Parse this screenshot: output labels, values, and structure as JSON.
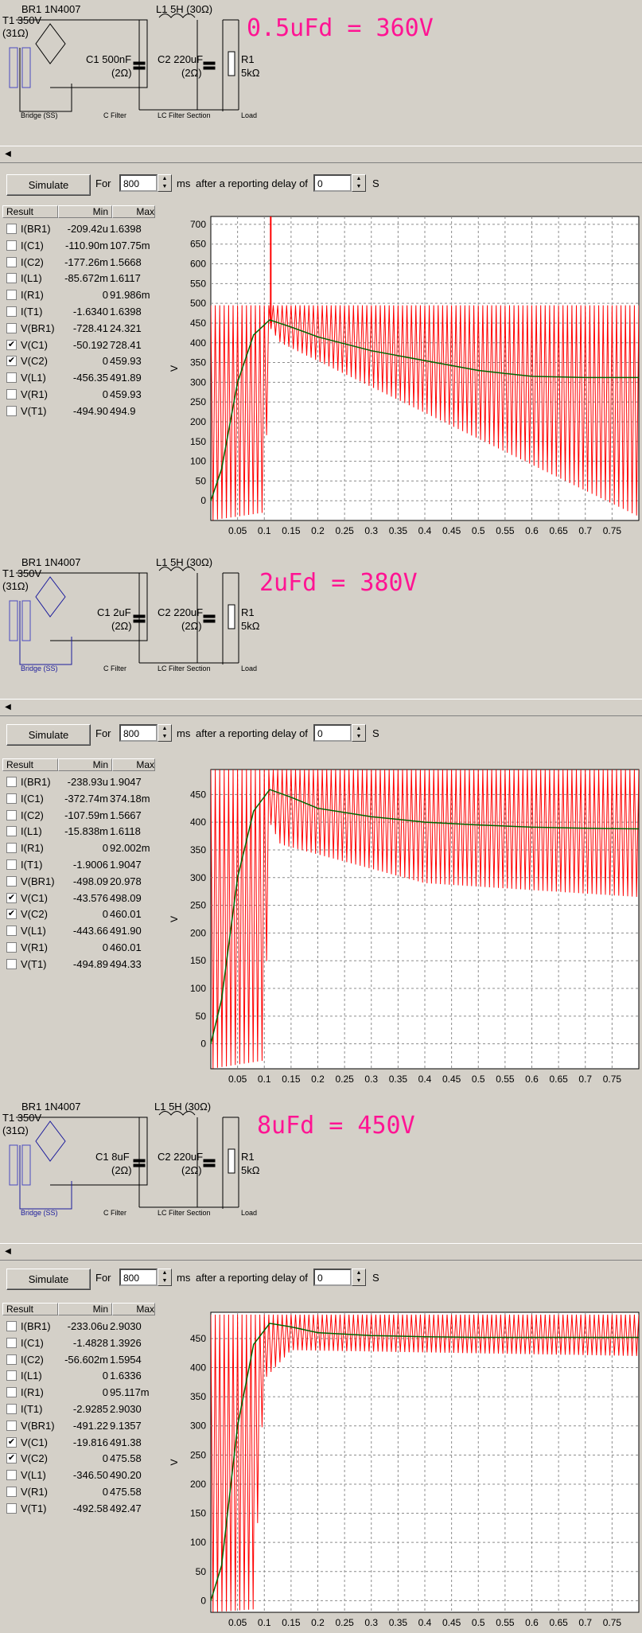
{
  "panels": [
    {
      "headline": "0.5uFd = 360V",
      "schematic": {
        "br1": "BR1 1N4007",
        "t1": "T1 350V",
        "t1_r": "(31Ω)",
        "l1": "L1 5H (30Ω)",
        "c1": "C1 500nF",
        "c1_r": "(2Ω)",
        "c2": "C2 220uF",
        "c2_r": "(2Ω)",
        "r1": "R1",
        "r1_v": "5kΩ",
        "sec_bridge": "Bridge (SS)",
        "sec_cfilter": "C Filter",
        "sec_lc": "LC Filter Section",
        "sec_load": "Load"
      },
      "toolbar": {
        "simulate": "Simulate",
        "for": "For",
        "ms": "800",
        "unit": "ms",
        "delay_text": "after a reporting delay of",
        "delay": "0",
        "s": "S"
      },
      "results": {
        "headers": [
          "Result",
          "Min",
          "Max"
        ],
        "rows": [
          {
            "name": "I(BR1)",
            "min": "-209.42u",
            "max": "1.6398",
            "checked": false
          },
          {
            "name": "I(C1)",
            "min": "-110.90m",
            "max": "107.75m",
            "checked": false
          },
          {
            "name": "I(C2)",
            "min": "-177.26m",
            "max": "1.5668",
            "checked": false
          },
          {
            "name": "I(L1)",
            "min": "-85.672m",
            "max": "1.6117",
            "checked": false
          },
          {
            "name": "I(R1)",
            "min": "0",
            "max": "91.986m",
            "checked": false
          },
          {
            "name": "I(T1)",
            "min": "-1.6340",
            "max": "1.6398",
            "checked": false
          },
          {
            "name": "V(BR1)",
            "min": "-728.41",
            "max": "24.321",
            "checked": false
          },
          {
            "name": "V(C1)",
            "min": "-50.192",
            "max": "728.41",
            "checked": true
          },
          {
            "name": "V(C2)",
            "min": "0",
            "max": "459.93",
            "checked": true
          },
          {
            "name": "V(L1)",
            "min": "-456.35",
            "max": "491.89",
            "checked": false
          },
          {
            "name": "V(R1)",
            "min": "0",
            "max": "459.93",
            "checked": false
          },
          {
            "name": "V(T1)",
            "min": "-494.90",
            "max": "494.9",
            "checked": false
          }
        ]
      },
      "chart_data": {
        "type": "line",
        "ylabel": "V",
        "xlim": [
          0,
          0.8
        ],
        "ylim": [
          -50,
          720
        ],
        "yticks": [
          0,
          50,
          100,
          150,
          200,
          250,
          300,
          350,
          400,
          450,
          500,
          550,
          600,
          650,
          700
        ],
        "xticks": [
          "0.05",
          "0.1",
          "0.15",
          "0.2",
          "0.25",
          "0.3",
          "0.35",
          "0.4",
          "0.45",
          "0.5",
          "0.55",
          "0.6",
          "0.65",
          "0.7",
          "0.75"
        ],
        "series": [
          {
            "name": "V(C1)",
            "color": "#ff0000",
            "peak": 495,
            "spike": 728,
            "envelope_low": [
              [
                0,
                -50
              ],
              [
                0.1,
                -30
              ],
              [
                0.11,
                440
              ],
              [
                0.13,
                400
              ],
              [
                0.8,
                -40
              ]
            ]
          },
          {
            "name": "V(C2)",
            "color": "#006400",
            "points": [
              [
                0,
                0
              ],
              [
                0.02,
                80
              ],
              [
                0.05,
                300
              ],
              [
                0.08,
                420
              ],
              [
                0.11,
                458
              ],
              [
                0.15,
                440
              ],
              [
                0.2,
                415
              ],
              [
                0.3,
                380
              ],
              [
                0.4,
                355
              ],
              [
                0.5,
                330
              ],
              [
                0.6,
                315
              ],
              [
                0.7,
                312
              ],
              [
                0.8,
                312
              ]
            ]
          }
        ]
      }
    },
    {
      "headline": "2uFd = 380V",
      "schematic": {
        "br1": "BR1 1N4007",
        "t1": "T1 350V",
        "t1_r": "(31Ω)",
        "l1": "L1 5H (30Ω)",
        "c1": "C1 2uF",
        "c1_r": "(2Ω)",
        "c2": "C2 220uF",
        "c2_r": "(2Ω)",
        "r1": "R1",
        "r1_v": "5kΩ",
        "sec_bridge": "Bridge (SS)",
        "sec_cfilter": "C Filter",
        "sec_lc": "LC Filter Section",
        "sec_load": "Load"
      },
      "toolbar": {
        "simulate": "Simulate",
        "for": "For",
        "ms": "800",
        "unit": "ms",
        "delay_text": "after a reporting delay of",
        "delay": "0",
        "s": "S"
      },
      "results": {
        "headers": [
          "Result",
          "Min",
          "Max"
        ],
        "rows": [
          {
            "name": "I(BR1)",
            "min": "-238.93u",
            "max": "1.9047",
            "checked": false
          },
          {
            "name": "I(C1)",
            "min": "-372.74m",
            "max": "374.18m",
            "checked": false
          },
          {
            "name": "I(C2)",
            "min": "-107.59m",
            "max": "1.5667",
            "checked": false
          },
          {
            "name": "I(L1)",
            "min": "-15.838m",
            "max": "1.6118",
            "checked": false
          },
          {
            "name": "I(R1)",
            "min": "0",
            "max": "92.002m",
            "checked": false
          },
          {
            "name": "I(T1)",
            "min": "-1.9006",
            "max": "1.9047",
            "checked": false
          },
          {
            "name": "V(BR1)",
            "min": "-498.09",
            "max": "20.978",
            "checked": false
          },
          {
            "name": "V(C1)",
            "min": "-43.576",
            "max": "498.09",
            "checked": true
          },
          {
            "name": "V(C2)",
            "min": "0",
            "max": "460.01",
            "checked": true
          },
          {
            "name": "V(L1)",
            "min": "-443.66",
            "max": "491.90",
            "checked": false
          },
          {
            "name": "V(R1)",
            "min": "0",
            "max": "460.01",
            "checked": false
          },
          {
            "name": "V(T1)",
            "min": "-494.89",
            "max": "494.33",
            "checked": false
          }
        ]
      },
      "chart_data": {
        "type": "line",
        "ylabel": "V",
        "xlim": [
          0,
          0.8
        ],
        "ylim": [
          -45,
          495
        ],
        "yticks": [
          0,
          50,
          100,
          150,
          200,
          250,
          300,
          350,
          400,
          450
        ],
        "xticks": [
          "0.05",
          "0.1",
          "0.15",
          "0.2",
          "0.25",
          "0.3",
          "0.35",
          "0.4",
          "0.45",
          "0.5",
          "0.55",
          "0.6",
          "0.65",
          "0.7",
          "0.75"
        ],
        "series": [
          {
            "name": "V(C1)",
            "color": "#ff0000",
            "peak": 495,
            "envelope_low": [
              [
                0,
                -45
              ],
              [
                0.1,
                -30
              ],
              [
                0.11,
                400
              ],
              [
                0.13,
                360
              ],
              [
                0.4,
                290
              ],
              [
                0.8,
                265
              ]
            ]
          },
          {
            "name": "V(C2)",
            "color": "#006400",
            "points": [
              [
                0,
                0
              ],
              [
                0.02,
                80
              ],
              [
                0.05,
                300
              ],
              [
                0.08,
                420
              ],
              [
                0.11,
                459
              ],
              [
                0.15,
                445
              ],
              [
                0.2,
                425
              ],
              [
                0.3,
                410
              ],
              [
                0.4,
                400
              ],
              [
                0.5,
                395
              ],
              [
                0.6,
                391
              ],
              [
                0.7,
                389
              ],
              [
                0.8,
                388
              ]
            ]
          }
        ]
      }
    },
    {
      "headline": "8uFd = 450V",
      "schematic": {
        "br1": "BR1 1N4007",
        "t1": "T1 350V",
        "t1_r": "(31Ω)",
        "l1": "L1 5H (30Ω)",
        "c1": "C1 8uF",
        "c1_r": "(2Ω)",
        "c2": "C2 220uF",
        "c2_r": "(2Ω)",
        "r1": "R1",
        "r1_v": "5kΩ",
        "sec_bridge": "Bridge (SS)",
        "sec_cfilter": "C Filter",
        "sec_lc": "LC Filter Section",
        "sec_load": "Load"
      },
      "toolbar": {
        "simulate": "Simulate",
        "for": "For",
        "ms": "800",
        "unit": "ms",
        "delay_text": "after a reporting delay of",
        "delay": "0",
        "s": "S"
      },
      "results": {
        "headers": [
          "Result",
          "Min",
          "Max"
        ],
        "rows": [
          {
            "name": "I(BR1)",
            "min": "-233.06u",
            "max": "2.9030",
            "checked": false
          },
          {
            "name": "I(C1)",
            "min": "-1.4828",
            "max": "1.3926",
            "checked": false
          },
          {
            "name": "I(C2)",
            "min": "-56.602m",
            "max": "1.5954",
            "checked": false
          },
          {
            "name": "I(L1)",
            "min": "0",
            "max": "1.6336",
            "checked": false
          },
          {
            "name": "I(R1)",
            "min": "0",
            "max": "95.117m",
            "checked": false
          },
          {
            "name": "I(T1)",
            "min": "-2.9285",
            "max": "2.9030",
            "checked": false
          },
          {
            "name": "V(BR1)",
            "min": "-491.22",
            "max": "9.1357",
            "checked": false
          },
          {
            "name": "V(C1)",
            "min": "-19.816",
            "max": "491.38",
            "checked": true
          },
          {
            "name": "V(C2)",
            "min": "0",
            "max": "475.58",
            "checked": true
          },
          {
            "name": "V(L1)",
            "min": "-346.50",
            "max": "490.20",
            "checked": false
          },
          {
            "name": "V(R1)",
            "min": "0",
            "max": "475.58",
            "checked": false
          },
          {
            "name": "V(T1)",
            "min": "-492.58",
            "max": "492.47",
            "checked": false
          }
        ]
      },
      "chart_data": {
        "type": "line",
        "ylabel": "V",
        "xlim": [
          0,
          0.8
        ],
        "ylim": [
          -20,
          495
        ],
        "yticks": [
          0,
          50,
          100,
          150,
          200,
          250,
          300,
          350,
          400,
          450
        ],
        "xticks": [
          "0.05",
          "0.1",
          "0.15",
          "0.2",
          "0.25",
          "0.3",
          "0.35",
          "0.4",
          "0.45",
          "0.5",
          "0.55",
          "0.6",
          "0.65",
          "0.7",
          "0.75"
        ],
        "series": [
          {
            "name": "V(C1)",
            "color": "#ff0000",
            "peak": 491,
            "envelope_low": [
              [
                0,
                -20
              ],
              [
                0.08,
                -15
              ],
              [
                0.1,
                380
              ],
              [
                0.15,
                430
              ],
              [
                0.8,
                420
              ]
            ]
          },
          {
            "name": "V(C2)",
            "color": "#006400",
            "points": [
              [
                0,
                0
              ],
              [
                0.02,
                60
              ],
              [
                0.05,
                300
              ],
              [
                0.08,
                440
              ],
              [
                0.11,
                476
              ],
              [
                0.15,
                470
              ],
              [
                0.2,
                460
              ],
              [
                0.3,
                455
              ],
              [
                0.4,
                453
              ],
              [
                0.5,
                452
              ],
              [
                0.6,
                452
              ],
              [
                0.7,
                452
              ],
              [
                0.8,
                452
              ]
            ]
          }
        ]
      }
    }
  ]
}
